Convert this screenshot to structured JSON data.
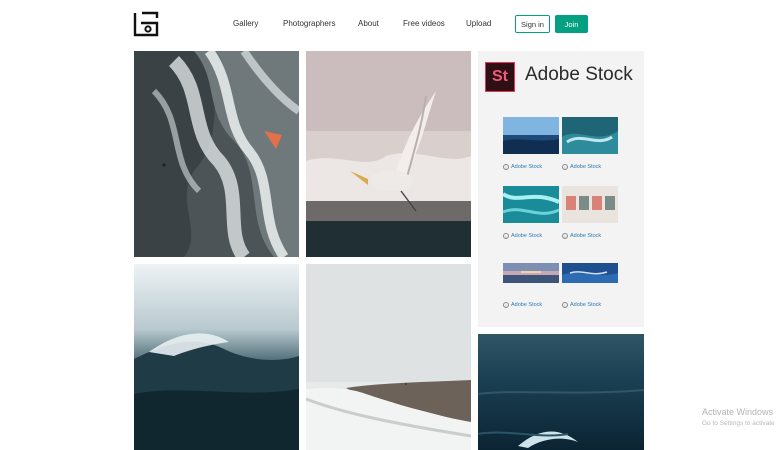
{
  "header": {
    "nav": [
      "Gallery",
      "Photographers",
      "About",
      "Free videos",
      "Upload"
    ],
    "signin_label": "Sign in",
    "join_label": "Join"
  },
  "stock": {
    "logo_text": "St",
    "title": "Adobe Stock",
    "credits": [
      "Adobe Stock",
      "Adobe Stock",
      "Adobe Stock",
      "Adobe Stock",
      "Adobe Stock",
      "Adobe Stock"
    ]
  },
  "watermark": {
    "line1": "Activate Windows",
    "line2": "Go to Settings to activate"
  },
  "colors": {
    "accent": "#05a081",
    "stock_logo_bg": "#2d0f14",
    "stock_logo_border": "#e8345f"
  }
}
